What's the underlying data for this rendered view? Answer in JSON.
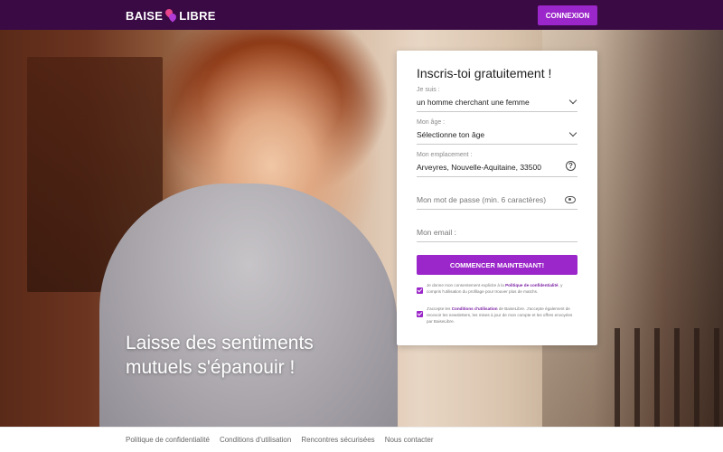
{
  "header": {
    "logo_text_left": "BAISE",
    "logo_text_right": "LIBRE",
    "login_label": "CONNEXION"
  },
  "hero": {
    "tagline_line1": "Laisse des sentiments",
    "tagline_line2": "mutuels s'épanouir !"
  },
  "form": {
    "title": "Inscris-toi gratuitement !",
    "i_am_label": "Je suis :",
    "i_am_value": "un homme cherchant une femme",
    "age_label": "Mon âge :",
    "age_value": "Sélectionne ton âge",
    "location_label": "Mon emplacement :",
    "location_value": "Arveyres, Nouvelle-Aquitaine, 33500",
    "password_placeholder": "Mon mot de passe (min. 6 caractères)",
    "email_placeholder": "Mon email :",
    "submit_label": "COMMENCER MAINTENANT!",
    "consent1_pre": "Je donne mon consentement explicite à la",
    "consent1_link": "Politique de confidentialité",
    "consent1_post": ", y compris l'utilisation du profilage pour trouver plus de matchs.",
    "consent2_pre": "J'accepte les",
    "consent2_link": "Conditions d'utilisation",
    "consent2_post": "de BaiseLibre. J'accepte également de recevoir les newsletters, les mises à jour de mon compte et les offres envoyées par BaiseLibre."
  },
  "footer": {
    "links": [
      "Politique de confidentialité",
      "Conditions d'utilisation",
      "Rencontres sécurisées",
      "Nous contacter"
    ]
  },
  "colors": {
    "header_bg": "#3a0a44",
    "accent": "#9b26c9"
  }
}
